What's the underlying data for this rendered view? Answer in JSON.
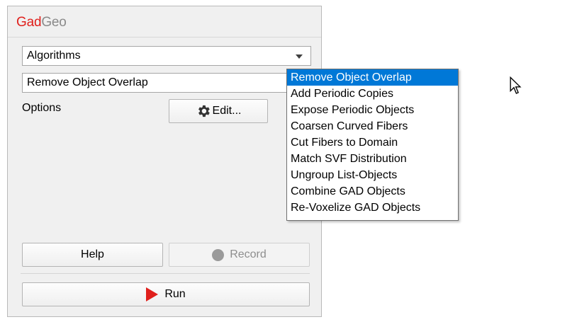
{
  "app": {
    "brand_primary": "Gad",
    "brand_secondary": "Geo"
  },
  "category_select": {
    "value": "Algorithms"
  },
  "algorithm_select": {
    "value": "Remove Object Overlap",
    "options": [
      "Remove Object Overlap",
      "Add Periodic Copies",
      "Expose Periodic Objects",
      "Coarsen Curved Fibers",
      "Cut Fibers to Domain",
      "Match SVF Distribution",
      "Ungroup List-Objects",
      "Combine GAD Objects",
      "Re-Voxelize GAD Objects"
    ],
    "highlighted_index": 0
  },
  "options": {
    "label": "Options",
    "edit_button": "Edit...",
    "edit_icon": "gear-icon"
  },
  "buttons": {
    "help": "Help",
    "record": "Record",
    "record_icon": "circle-icon",
    "run": "Run",
    "run_icon": "play-icon"
  },
  "colors": {
    "brand_red": "#e0201c",
    "highlight": "#0078d7"
  }
}
